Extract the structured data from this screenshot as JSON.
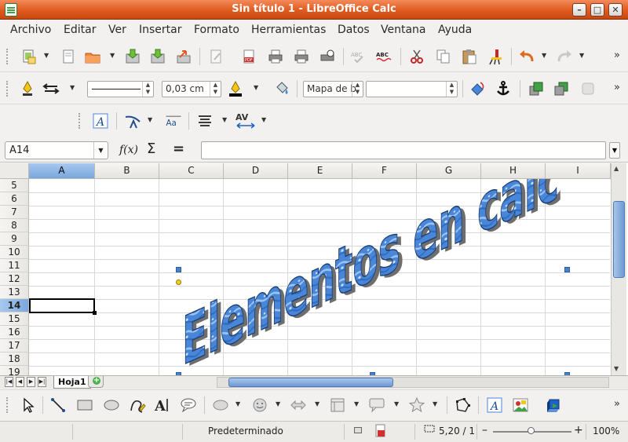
{
  "window": {
    "title": "Sin título 1 - LibreOffice Calc"
  },
  "menu": [
    "Archivo",
    "Editar",
    "Ver",
    "Insertar",
    "Formato",
    "Herramientas",
    "Datos",
    "Ventana",
    "Ayuda"
  ],
  "line_toolbar": {
    "line_width": "0,03 cm",
    "area_style": "Mapa de b",
    "area_fill": ""
  },
  "formula_bar": {
    "name_box": "A14",
    "formula": ""
  },
  "columns": [
    "A",
    "B",
    "C",
    "D",
    "E",
    "F",
    "G",
    "H",
    "I"
  ],
  "rows": [
    "5",
    "6",
    "7",
    "8",
    "9",
    "10",
    "11",
    "12",
    "13",
    "14",
    "15",
    "16",
    "17",
    "18",
    "19"
  ],
  "active_cell": {
    "column": "A",
    "row": "14"
  },
  "fontwork": {
    "text": "Elementos en calc",
    "fill_color": "#4a86d8",
    "shadow_color": "#6e6e6e"
  },
  "sheets": [
    "Hoja1"
  ],
  "status": {
    "page_style": "Predeterminado",
    "position": "5,20 / 1",
    "zoom": "100%",
    "zoom_level": 1.0
  },
  "colors": {
    "title_bar": "#e05b1f",
    "selection": "#7aa7de"
  }
}
